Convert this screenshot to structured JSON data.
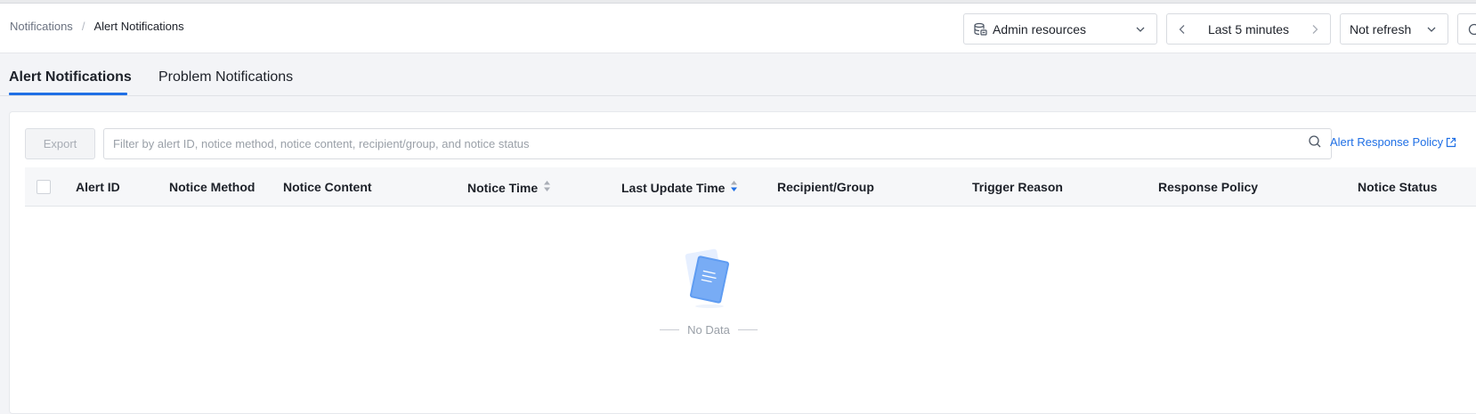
{
  "breadcrumb": {
    "parent": "Notifications",
    "separator": "/",
    "current": "Alert Notifications"
  },
  "header": {
    "resource_selector": "Admin resources",
    "time_range": "Last 5 minutes",
    "refresh_mode": "Not refresh"
  },
  "tabs": [
    {
      "label": "Alert Notifications",
      "active": true
    },
    {
      "label": "Problem Notifications",
      "active": false
    }
  ],
  "toolbar": {
    "export_label": "Export",
    "search_placeholder": "Filter by alert ID, notice method, notice content, recipient/group, and notice status",
    "policy_link": "Alert Response Policy"
  },
  "table": {
    "columns": [
      {
        "label": "Alert ID",
        "sortable": false
      },
      {
        "label": "Notice Method",
        "sortable": false
      },
      {
        "label": "Notice Content",
        "sortable": false
      },
      {
        "label": "Notice Time",
        "sortable": true,
        "sort": "none"
      },
      {
        "label": "Last Update Time",
        "sortable": true,
        "sort": "descending"
      },
      {
        "label": "Recipient/Group",
        "sortable": false
      },
      {
        "label": "Trigger Reason",
        "sortable": false
      },
      {
        "label": "Response Policy",
        "sortable": false
      },
      {
        "label": "Notice Status",
        "sortable": false
      }
    ],
    "rows": [],
    "empty_text": "No Data"
  },
  "colors": {
    "accent": "#1f6fe5",
    "sort_inactive": "#a9aeb6"
  }
}
